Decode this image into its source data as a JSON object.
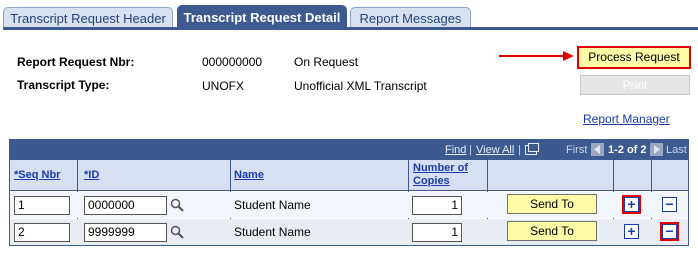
{
  "tabs": [
    {
      "label": "Transcript Request Header",
      "active": false
    },
    {
      "label": "Transcript Request Detail",
      "active": true
    },
    {
      "label": "Report Messages",
      "active": false
    }
  ],
  "form": {
    "report_request_nbr_label": "Report Request Nbr:",
    "report_request_nbr_value": "000000000",
    "status_value": "On Request",
    "transcript_type_label": "Transcript Type:",
    "transcript_type_code": "UNOFX",
    "transcript_type_desc": "Unofficial XML Transcript"
  },
  "buttons": {
    "process_request": "Process Request",
    "print": "Print"
  },
  "links": {
    "report_manager": "Report Manager"
  },
  "grid": {
    "nav": {
      "find": "Find",
      "sep": "|",
      "view_all": "View All",
      "first": "First",
      "range": "1-2 of 2",
      "last": "Last"
    },
    "columns": {
      "seq": "*Seq Nbr",
      "id": "*ID",
      "name": "Name",
      "copies_line1": "Number of",
      "copies_line2": "Copies"
    },
    "rows": [
      {
        "seq": "1",
        "id": "0000000",
        "name": "Student Name",
        "copies": "1",
        "send_to": "Send To",
        "add": "+",
        "remove": "−"
      },
      {
        "seq": "2",
        "id": "9999999",
        "name": "Student Name",
        "copies": "1",
        "send_to": "Send To",
        "add": "+",
        "remove": "−"
      }
    ]
  },
  "colors": {
    "tab_active": "#3c5a8f",
    "highlight": "#e00000",
    "button_yellow": "#fdfba8",
    "link": "#1a3caa"
  }
}
